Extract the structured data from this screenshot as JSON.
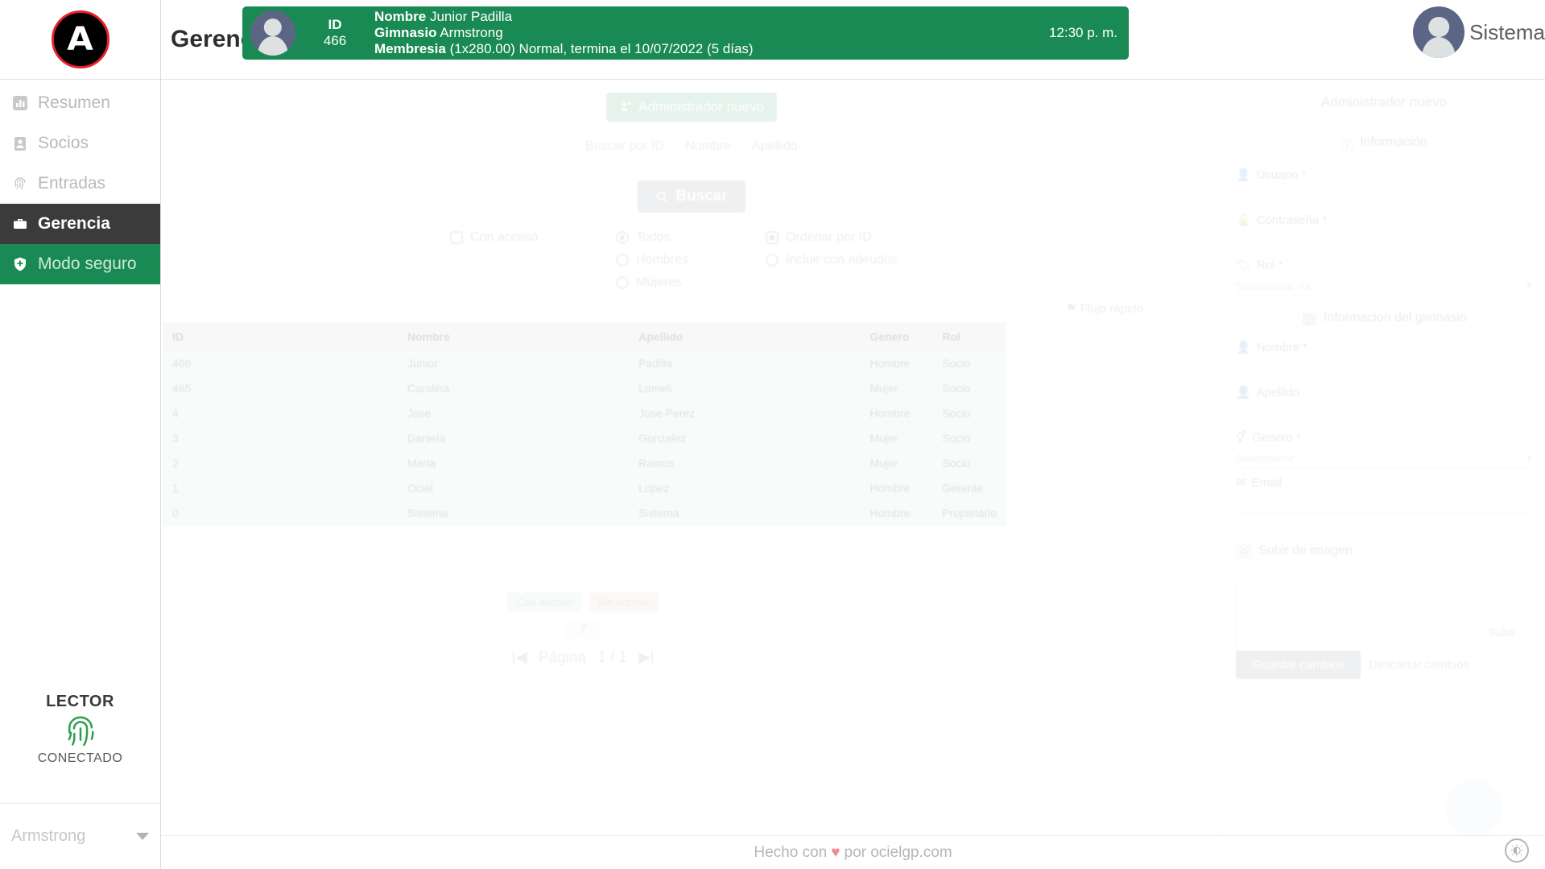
{
  "brand": {
    "logo_letter": "A"
  },
  "sidebar": {
    "items": [
      {
        "label": "Resumen",
        "icon": "chart-bar-icon",
        "state": "idle"
      },
      {
        "label": "Socios",
        "icon": "id-card-icon",
        "state": "idle"
      },
      {
        "label": "Entradas",
        "icon": "fingerprint-icon",
        "state": "idle"
      },
      {
        "label": "Gerencia",
        "icon": "briefcase-icon",
        "state": "active"
      },
      {
        "label": "Modo seguro",
        "icon": "shield-icon",
        "state": "secure"
      }
    ],
    "reader": {
      "title": "LECTOR",
      "status": "CONECTADO",
      "icon": "fingerprint-icon"
    },
    "gym_selector": {
      "value": "Armstrong",
      "icon": "chevron-down-icon"
    }
  },
  "topbar": {
    "page_title": "Gerencia",
    "user": {
      "name": "Sistema",
      "avatar": "user-avatar"
    }
  },
  "notification": {
    "avatar": "member-avatar",
    "id_label": "ID",
    "id_value": "466",
    "rows": [
      {
        "key": "Nombre",
        "value": "Junior Padilla"
      },
      {
        "key": "Gimnasio",
        "value": "Armstrong"
      },
      {
        "key": "Membresia",
        "value": "(1x280.00) Normal, termina el 10/07/2022 (5 días)"
      }
    ],
    "time": "12:30 p. m.",
    "color": "#1a8a54"
  },
  "main": {
    "add_member_button": "Administrador nuevo",
    "tabs": [
      "Buscar por ID",
      "Nombre",
      "Apellido"
    ],
    "search_button": "Buscar",
    "filters": [
      {
        "label": "Con acceso",
        "type": "checkbox",
        "selected": false
      },
      {
        "label": "Todos",
        "type": "radio",
        "selected": true
      },
      {
        "label": "Ordenar por ID",
        "type": "checkbox",
        "selected": true
      },
      {
        "label": "Hombres",
        "type": "radio",
        "selected": false
      },
      {
        "label": "Incluir con adeudos",
        "type": "radio",
        "selected": false
      },
      {
        "label": "Mujeres",
        "type": "radio",
        "selected": false
      }
    ],
    "flag_link": "Flujo rápido",
    "table": {
      "columns": [
        "ID",
        "Nombre",
        "Apellido",
        "Genero",
        "Rol"
      ],
      "rows": [
        [
          "466",
          "Junior",
          "Padilla",
          "Hombre",
          "Socio"
        ],
        [
          "465",
          "Carolina",
          "Lomeli",
          "Mujer",
          "Socio"
        ],
        [
          "4",
          "Jose",
          "Jose Perez",
          "Hombre",
          "Socio"
        ],
        [
          "3",
          "Daniela",
          "Gonzalez",
          "Mujer",
          "Socio"
        ],
        [
          "2",
          "Maria",
          "Ramos",
          "Mujer",
          "Socio"
        ],
        [
          "1",
          "Ociel",
          "Lopez",
          "Hombre",
          "Gerente"
        ],
        [
          "0",
          "Sistema",
          "Sistema",
          "Hombre",
          "Propietario"
        ]
      ]
    },
    "badges": {
      "active": "Con acceso",
      "inactive": "Sin acceso"
    },
    "result_count": "7",
    "pagination": {
      "first_icon": "first-page-icon",
      "label": "Página",
      "value": "1 / 1",
      "last_icon": "last-page-icon"
    }
  },
  "right_panel": {
    "title": "Administrador nuevo",
    "section": "Información",
    "fields": [
      {
        "label": "Usuario *",
        "value": ""
      },
      {
        "label": "Contraseña *",
        "value": ""
      },
      {
        "label": "Rol *",
        "value": "Seleccionar rol"
      },
      {
        "label": "Informacion del gimnasio",
        "value": ""
      },
      {
        "label": "Nombre *",
        "value": ""
      },
      {
        "label": "Apellido",
        "value": ""
      },
      {
        "label": "Genero *",
        "value": "Seleccionar"
      },
      {
        "label": "Email",
        "value": ""
      }
    ],
    "photo_section": {
      "label": "Subir de imagen",
      "note": "Subir"
    },
    "actions": {
      "save": "Guardar cambios",
      "clear": "Descartar cambios"
    }
  },
  "footer": {
    "text_before": "Hecho con",
    "heart": "♥",
    "text_after": "por ocielgp.com"
  },
  "theme_toggle": {
    "icon": "brightness-icon"
  }
}
